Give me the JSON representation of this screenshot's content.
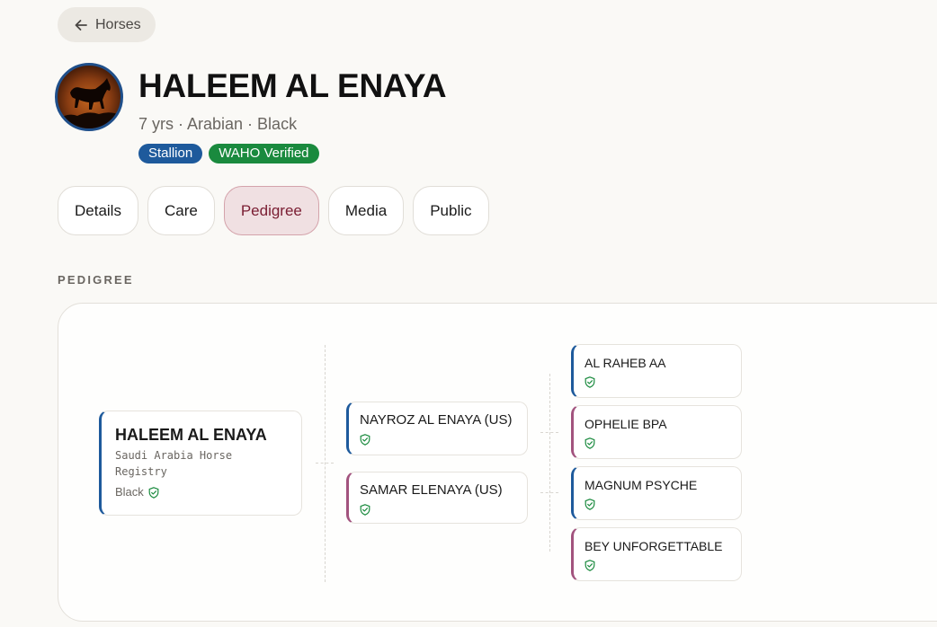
{
  "nav": {
    "back_label": "Horses"
  },
  "horse": {
    "name": "HALEEM AL ENAYA",
    "subtitle": "7 yrs · Arabian · Black",
    "badges": [
      {
        "label": "Stallion",
        "color": "#1e5a9c"
      },
      {
        "label": "WAHO Verified",
        "color": "#1a8a3e"
      }
    ]
  },
  "tabs": [
    {
      "label": "Details",
      "active": false
    },
    {
      "label": "Care",
      "active": false
    },
    {
      "label": "Pedigree",
      "active": true
    },
    {
      "label": "Media",
      "active": false
    },
    {
      "label": "Public",
      "active": false
    }
  ],
  "pedigree": {
    "section_label": "PEDIGREE",
    "root": {
      "name": "HALEEM AL ENAYA",
      "registry": "Saudi Arabia Horse Registry",
      "color": "Black"
    },
    "parents": [
      {
        "name": "NAYROZ AL ENAYA (US)",
        "sex": "sire"
      },
      {
        "name": "SAMAR ELENAYA (US)",
        "sex": "dam"
      }
    ],
    "grandparents": [
      {
        "name": "AL RAHEB AA",
        "sex": "sire"
      },
      {
        "name": "OPHELIE BPA",
        "sex": "dam"
      },
      {
        "name": "MAGNUM PSYCHE",
        "sex": "sire"
      },
      {
        "name": "BEY UNFORGETTABLE",
        "sex": "dam"
      }
    ]
  },
  "colors": {
    "sire_accent": "#1e5a9c",
    "dam_accent": "#a2537e",
    "verified_green": "#1a8a3e",
    "active_tab_text": "#7a1d32"
  }
}
